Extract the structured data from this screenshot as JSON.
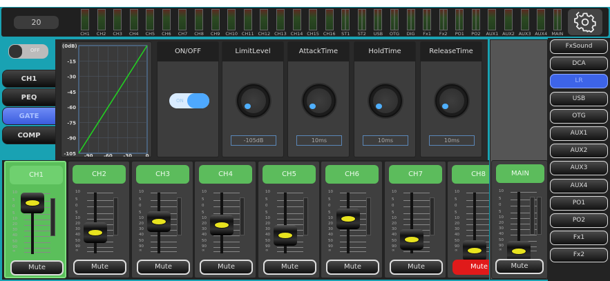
{
  "top": {
    "preset": "20",
    "meters": [
      "CH1",
      "CH2",
      "CH3",
      "CH4",
      "CH5",
      "CH6",
      "CH7",
      "CH8",
      "CH9",
      "CH10",
      "CH11",
      "CH12",
      "CH13",
      "CH14",
      "CH15",
      "CH16",
      "ST1",
      "ST2",
      "USB",
      "OTG",
      "DIG",
      "Fx1",
      "Fx2",
      "PO1",
      "PO2",
      "AUX1",
      "AUX2",
      "AUX3",
      "AUX4",
      "MAIN"
    ],
    "dual": [
      "ST1",
      "ST2",
      "USB",
      "OTG",
      "DIG",
      "Fx1",
      "Fx2",
      "PO1",
      "PO2",
      "MAIN"
    ]
  },
  "left": {
    "toggle": "OFF",
    "tabs": [
      "CH1",
      "PEQ",
      "GATE",
      "COMP"
    ],
    "active_tab": "GATE"
  },
  "graph": {
    "ylabel": "(0dB)",
    "yticks": [
      "-15",
      "-30",
      "-45",
      "-60",
      "-75",
      "-90",
      "-105"
    ],
    "xticks": [
      "-90",
      "-60",
      "-30",
      "0"
    ]
  },
  "gate": {
    "onoff": {
      "title": "ON/OFF",
      "state": "ON"
    },
    "knobs": [
      {
        "title": "LimitLevel",
        "value": "-105dB",
        "fraction": 0
      },
      {
        "title": "AttackTime",
        "value": "10ms",
        "fraction": 0.02
      },
      {
        "title": "HoldTime",
        "value": "10ms",
        "fraction": 0.02
      },
      {
        "title": "ReleaseTime",
        "value": "10ms",
        "fraction": 0.02
      }
    ]
  },
  "scale": [
    "10",
    "5",
    "0",
    "5",
    "10",
    "20",
    "30",
    "40",
    "50",
    "90",
    "∞"
  ],
  "channels": [
    {
      "name": "CH1",
      "fader": 0.83,
      "mute": "Mute",
      "muted": false,
      "selected": true
    },
    {
      "name": "CH2",
      "fader": 0.31,
      "mute": "Mute",
      "muted": false
    },
    {
      "name": "CH3",
      "fader": 0.5,
      "mute": "Mute",
      "muted": false
    },
    {
      "name": "CH4",
      "fader": 0.44,
      "mute": "Mute",
      "muted": false
    },
    {
      "name": "CH5",
      "fader": 0.26,
      "mute": "Mute",
      "muted": false
    },
    {
      "name": "CH6",
      "fader": 0.55,
      "mute": "Mute",
      "muted": false
    },
    {
      "name": "CH7",
      "fader": 0.19,
      "mute": "Mute",
      "muted": false
    },
    {
      "name": "CH8",
      "fader": 0.0,
      "mute": "Mute",
      "muted": true
    }
  ],
  "main": {
    "name": "MAIN",
    "fader": 0.0,
    "mute": "Mute"
  },
  "buses": [
    "FxSound",
    "DCA",
    "LR",
    "USB",
    "OTG",
    "AUX1",
    "AUX2",
    "AUX3",
    "AUX4",
    "PO1",
    "PO2",
    "Fx1",
    "Fx2"
  ],
  "active_bus": "LR",
  "colors": {
    "accent": "#3d64e8",
    "green": "#5cbc5c",
    "mute_on": "#e01a1a",
    "frame": "#19a2b3"
  }
}
